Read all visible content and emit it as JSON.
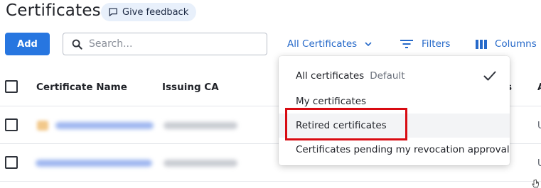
{
  "page": {
    "title": "Certificates",
    "feedback_label": "Give feedback"
  },
  "toolbar": {
    "add_label": "Add",
    "search_placeholder": "Search...",
    "view_selector_label": "All Certificates",
    "filters_label": "Filters",
    "columns_label": "Columns"
  },
  "table": {
    "columns": [
      "Certificate Name",
      "Issuing CA"
    ],
    "partial_column_labels": [
      "s",
      "A"
    ],
    "row_trailing_text": [
      "U",
      "U"
    ]
  },
  "dropdown": {
    "options": [
      {
        "label": "All certificates",
        "tag": "Default",
        "selected": true
      },
      {
        "label": "My certificates"
      },
      {
        "label": "Retired certificates",
        "highlighted": true
      },
      {
        "label": "Certificates pending my revocation approval"
      }
    ]
  },
  "colors": {
    "accent": "#2776e0",
    "link": "#2669c9",
    "annotation": "#d80b12"
  }
}
